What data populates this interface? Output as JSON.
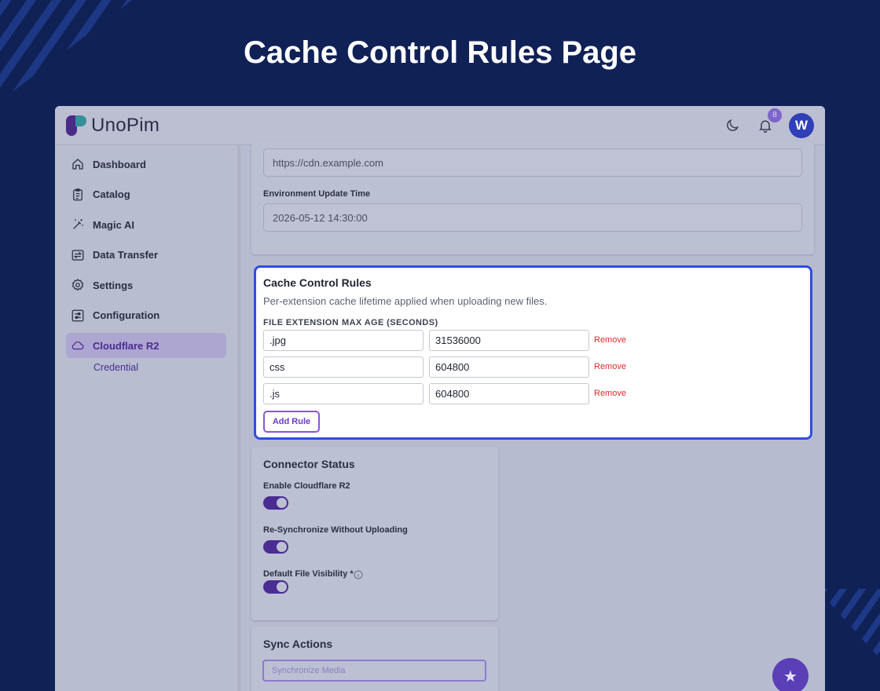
{
  "page_heading": "Cache Control Rules Page",
  "app": {
    "logo_text": "UnoPim",
    "notification_count": "8",
    "avatar_letter": "W"
  },
  "sidebar": {
    "items": [
      {
        "label": "Dashboard",
        "icon": "home-icon"
      },
      {
        "label": "Catalog",
        "icon": "clipboard-icon"
      },
      {
        "label": "Magic AI",
        "icon": "magic-wand-icon"
      },
      {
        "label": "Data Transfer",
        "icon": "transfer-icon"
      },
      {
        "label": "Settings",
        "icon": "gear-icon"
      },
      {
        "label": "Configuration",
        "icon": "sliders-icon"
      },
      {
        "label": "Cloudflare R2",
        "icon": "cloud-icon"
      }
    ],
    "sub_item": "Credential"
  },
  "environment": {
    "cdn_url": "https://cdn.example.com",
    "update_time_label": "Environment Update Time",
    "update_time_value": "2026-05-12 14:30:00"
  },
  "cache_rules": {
    "title": "Cache Control Rules",
    "description": "Per-extension cache lifetime applied when uploading new files.",
    "col_extension": "FILE EXTENSION",
    "col_max_age": "MAX AGE (SECONDS)",
    "rows": [
      {
        "extension": ".jpg",
        "max_age": "31536000",
        "remove": "Remove"
      },
      {
        "extension": "css",
        "max_age": "604800",
        "remove": "Remove"
      },
      {
        "extension": ".js",
        "max_age": "604800",
        "remove": "Remove"
      }
    ],
    "add_label": "Add Rule"
  },
  "connector": {
    "title": "Connector Status",
    "enable_label": "Enable Cloudflare R2",
    "resync_label": "Re-Synchronize Without Uploading",
    "visibility_label": "Default File Visibility *"
  },
  "sync": {
    "title": "Sync Actions",
    "button_label": "Synchronize Media"
  },
  "colors": {
    "background": "#102156",
    "highlight_border": "#2f4de0",
    "accent": "#4a2c92",
    "remove": "#d92d2d"
  }
}
